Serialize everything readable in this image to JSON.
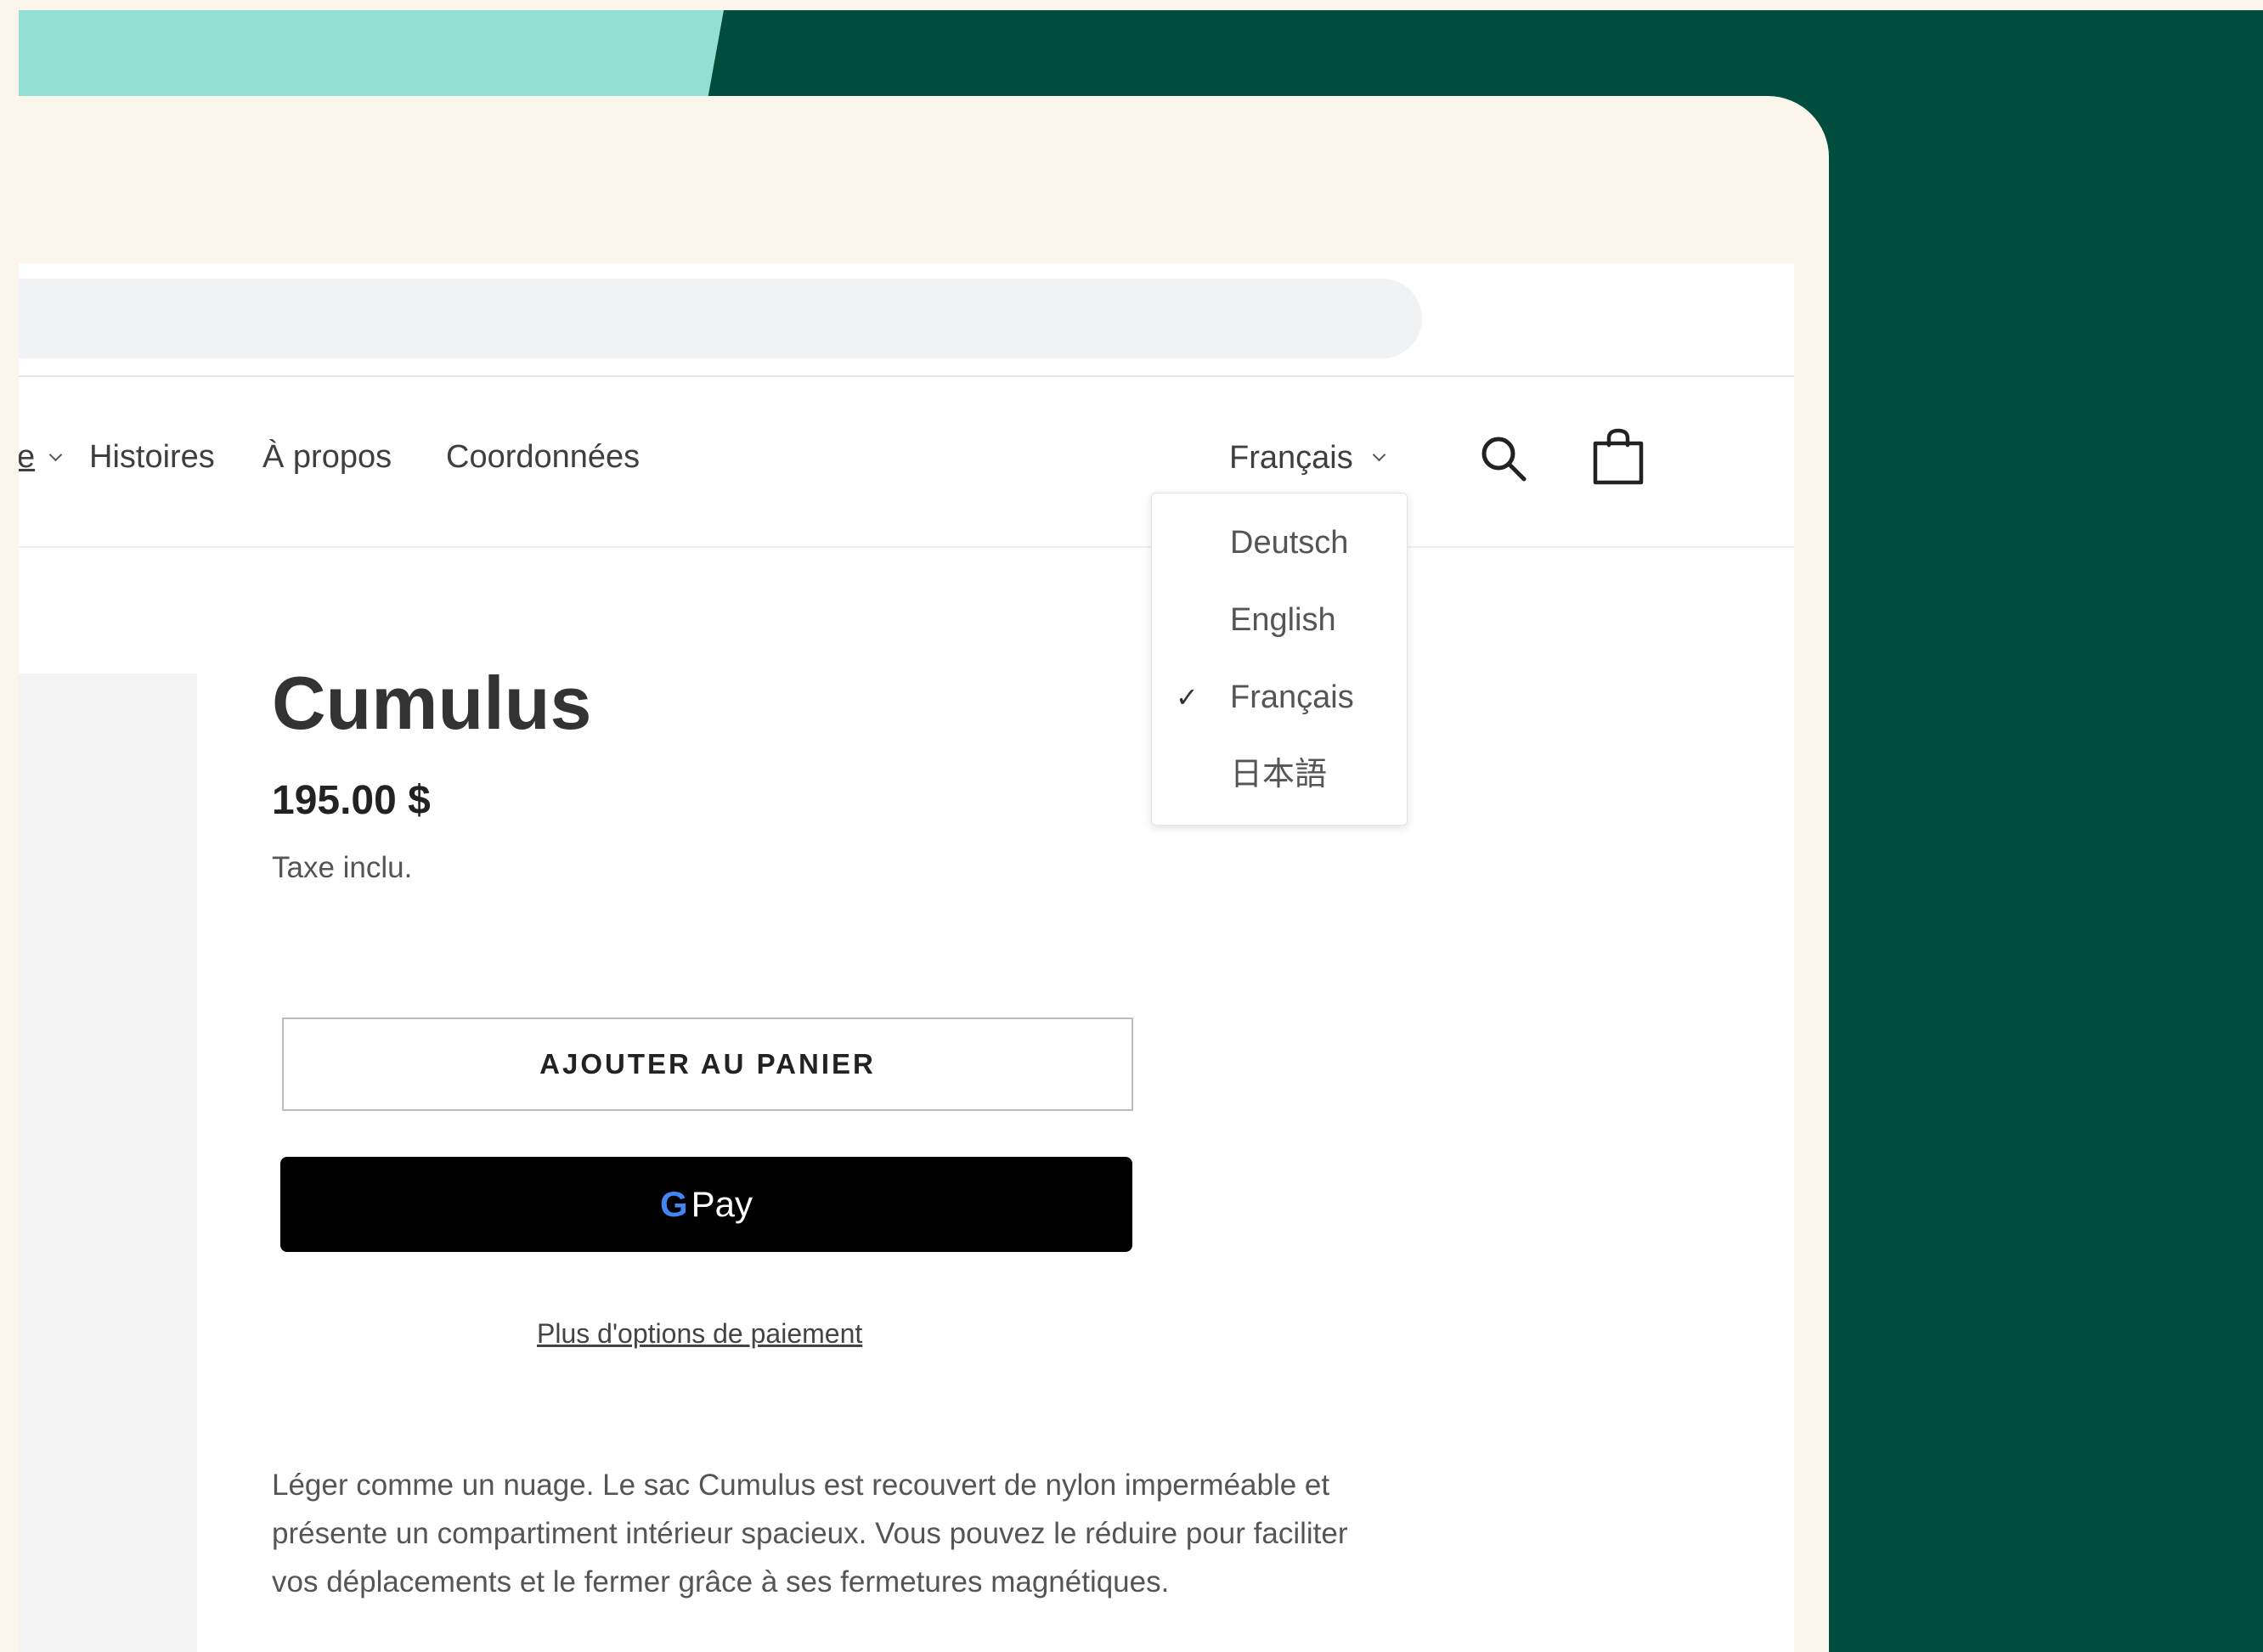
{
  "nav": {
    "cut_item": "e",
    "items": [
      "Histoires",
      "À propos",
      "Coordonnées"
    ]
  },
  "language": {
    "current": "Français",
    "options": [
      "Deutsch",
      "English",
      "Français",
      "日本語"
    ],
    "selected_index": 2,
    "check_mark": "✓"
  },
  "icons": {
    "search": "search-icon",
    "cart": "shopping-bag-icon",
    "chevron": "chevron-down-icon"
  },
  "product": {
    "title": "Cumulus",
    "price": "195.00 $",
    "tax_note": "Taxe inclu.",
    "add_to_cart_label": "AJOUTER AU PANIER",
    "gpay_g": "G",
    "gpay_label": "Pay",
    "more_payment_options": "Plus d'options de paiement",
    "description": "Léger comme un nuage. Le sac Cumulus est recouvert de nylon imperméable et présente un compartiment intérieur spacieux. Vous pouvez le réduire pour faciliter vos déplacements et le fermer grâce à ses fermetures magnétiques."
  },
  "colors": {
    "background_green": "#004d3e",
    "mint": "#94dfd3",
    "cream": "#faf6ec",
    "button_black": "#000000"
  }
}
